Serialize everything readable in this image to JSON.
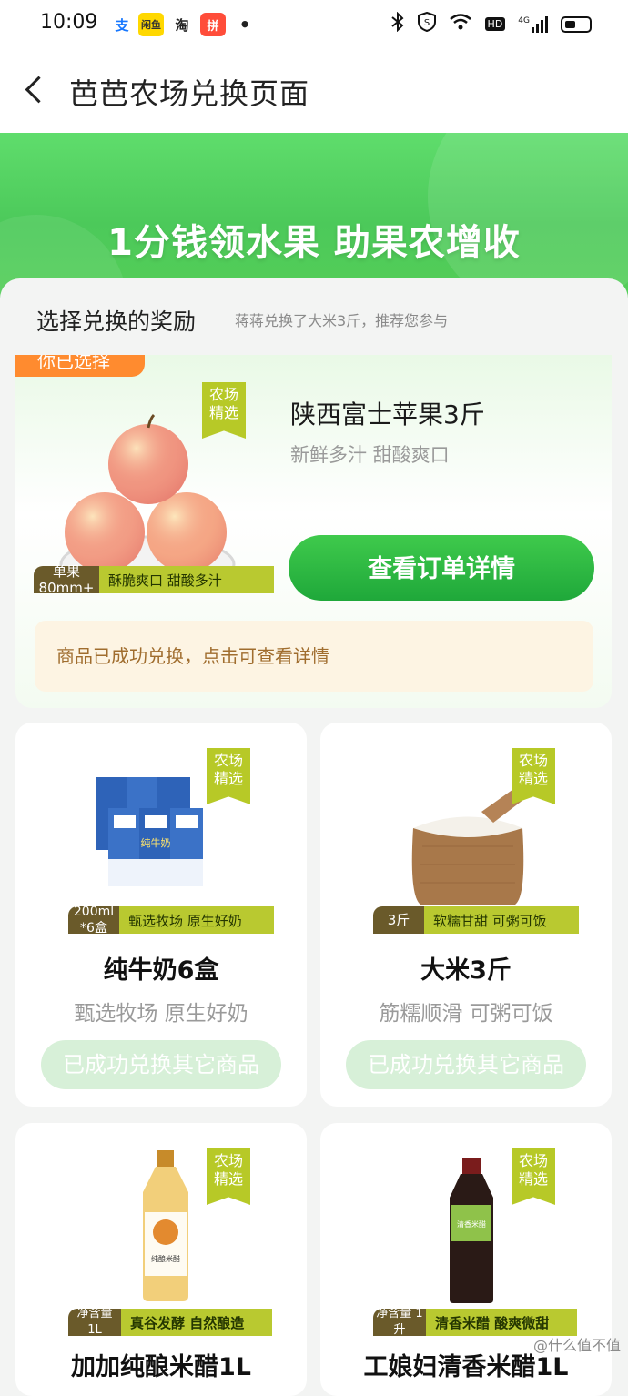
{
  "status_bar": {
    "time": "10:09",
    "apps": [
      "支",
      "闲鱼",
      "淘",
      "拼"
    ],
    "dot": "•",
    "network": "4G",
    "hd": "HD"
  },
  "header": {
    "title": "芭芭农场兑换页面"
  },
  "banner": {
    "text": "1分钱领水果 助果农增收"
  },
  "section": {
    "title": "选择兑换的奖励",
    "subtitle": "蒋蒋兑换了大米3斤，推荐您参与"
  },
  "featured": {
    "tag": "你已选择",
    "badge": "农场 精选",
    "name": "陕西富士苹果3斤",
    "desc": "新鲜多汁 甜酸爽口",
    "spec_left": "单果 80mm+",
    "spec_right": "酥脆爽口 甜酸多汁",
    "button": "查看订单详情",
    "notice": "商品已成功兑换，点击可查看详情"
  },
  "products": [
    {
      "badge": "农场 精选",
      "spec_left": "200ml *6盒",
      "spec_right": "甄选牧场 原生好奶",
      "name": "纯牛奶6盒",
      "desc": "甄选牧场 原生好奶",
      "button": "已成功兑换其它商品",
      "package_text": "纯牛奶"
    },
    {
      "badge": "农场 精选",
      "spec_left": "3斤",
      "spec_right": "软糯甘甜 可粥可饭",
      "name": "大米3斤",
      "desc": "筋糯顺滑 可粥可饭",
      "button": "已成功兑换其它商品"
    },
    {
      "badge": "农场 精选",
      "spec_left": "净含量 1L",
      "spec_right": "真谷发酵 自然酿造",
      "name": "加加纯酿米醋1L",
      "label_text": "纯酿米醋"
    },
    {
      "badge": "农场 精选",
      "spec_left": "净含量 1升",
      "spec_right": "清香米醋 酸爽微甜",
      "name": "工娘妇清香米醋1L",
      "label_text": "清香米醋"
    }
  ],
  "watermark": "@什么值不值",
  "colors": {
    "banner_green": "#4cc95a",
    "button_green": "#1fa83a",
    "badge_olive": "#b7c927",
    "tag_orange": "#ff8b2f",
    "notice_bg": "#fdf4e3",
    "disabled_button": "#d7f0d8"
  }
}
